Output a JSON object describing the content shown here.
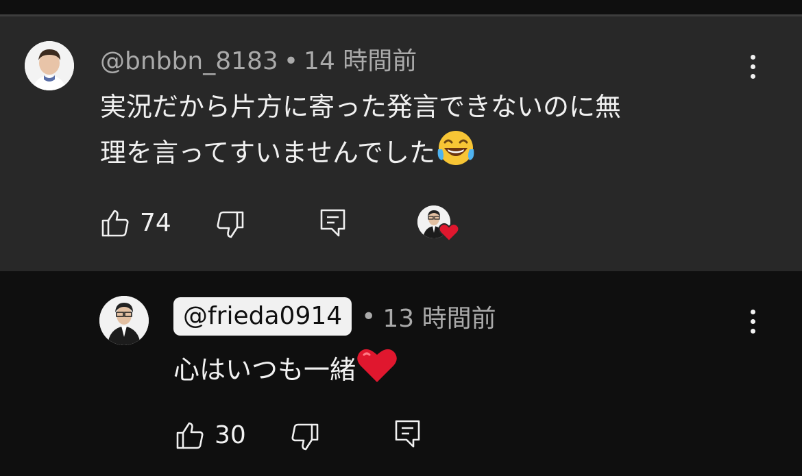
{
  "comment": {
    "author": "@bnbbn_8183",
    "separator": "•",
    "time": "14 時間前",
    "text_line1": "実況だから片方に寄った発言できないのに無",
    "text_line2": "理を言ってすいませんでした",
    "emoji": "face-with-tears-of-joy",
    "like_count": "74"
  },
  "reply": {
    "mention": "@frieda0914",
    "separator": "•",
    "time": "13 時間前",
    "text": "心はいつも一緒",
    "emoji": "red-heart",
    "like_count": "30"
  },
  "colors": {
    "comment_bg": "#282828",
    "page_bg": "#0f0f0f",
    "meta_text": "#aaaaaa",
    "text": "#f1f1f1",
    "heart": "#e0172e"
  }
}
